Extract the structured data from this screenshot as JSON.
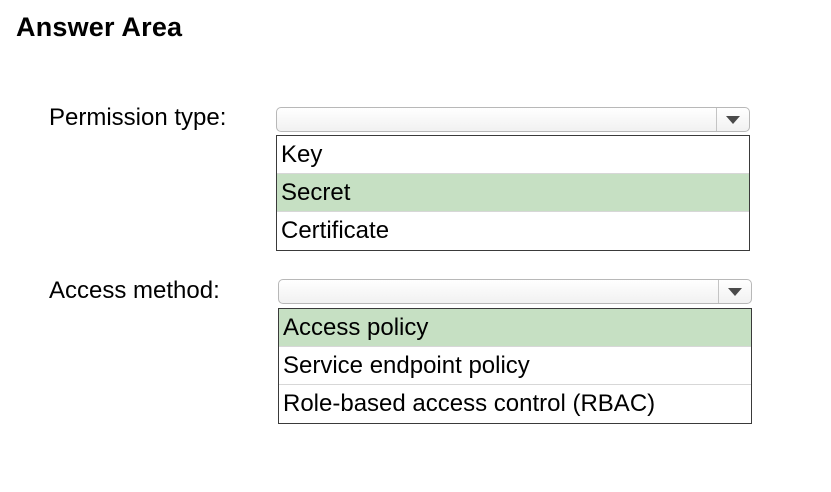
{
  "title": "Answer Area",
  "colors": {
    "selected_bg": "#c6e0c3",
    "list_border": "#3a3a3a"
  },
  "questions": [
    {
      "label": "Permission type:",
      "selected_value": "",
      "toggle_icon": "chevron-down-icon",
      "options": [
        {
          "label": "Key",
          "selected": false
        },
        {
          "label": "Secret",
          "selected": true
        },
        {
          "label": "Certificate",
          "selected": false
        }
      ]
    },
    {
      "label": "Access method:",
      "selected_value": "",
      "toggle_icon": "chevron-down-icon",
      "options": [
        {
          "label": "Access policy",
          "selected": true
        },
        {
          "label": "Service endpoint policy",
          "selected": false
        },
        {
          "label": "Role-based access control (RBAC)",
          "selected": false
        }
      ]
    }
  ]
}
